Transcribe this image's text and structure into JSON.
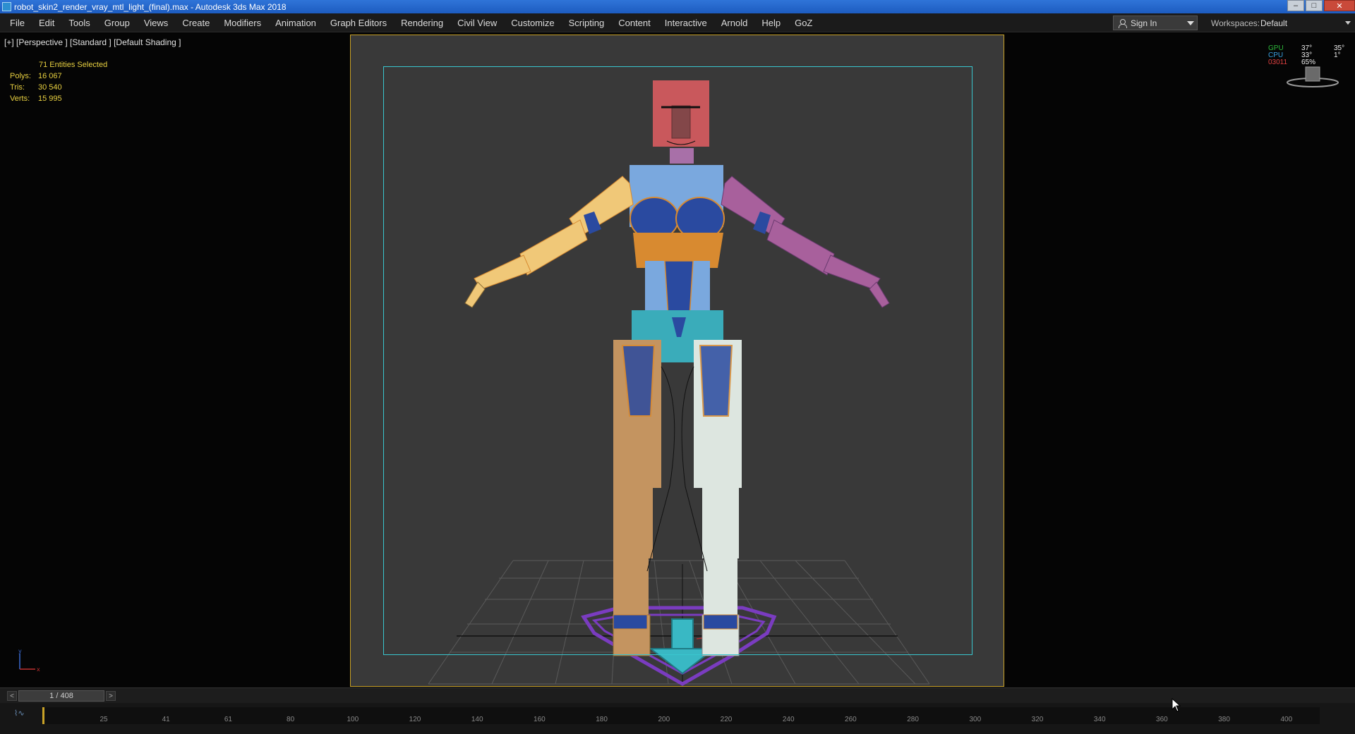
{
  "window": {
    "title": "robot_skin2_render_vray_mtl_light_(final).max - Autodesk 3ds Max 2018",
    "minimize": "–",
    "maximize": "□",
    "close": "✕"
  },
  "menu": {
    "items": [
      "File",
      "Edit",
      "Tools",
      "Group",
      "Views",
      "Create",
      "Modifiers",
      "Animation",
      "Graph Editors",
      "Rendering",
      "Civil View",
      "Customize",
      "Scripting",
      "Content",
      "Interactive",
      "Arnold",
      "Help",
      "GoZ"
    ],
    "sign_in": "Sign In",
    "workspaces_label": "Workspaces:",
    "workspace_value": "Default"
  },
  "viewport": {
    "label": "[+] [Perspective ] [Standard ] [Default Shading ]",
    "selection": "71 Entities Selected",
    "stats": [
      {
        "key": "Polys:",
        "value": "16 067"
      },
      {
        "key": "Tris:",
        "value": "30 540"
      },
      {
        "key": "Verts:",
        "value": "15 995"
      }
    ],
    "hud": {
      "gpu": "GPU",
      "cpu": "CPU",
      "fps": "03011",
      "gpu_v1": "37°",
      "gpu_v2": "35°",
      "cpu_v1": "33°",
      "cpu_v2": "1°",
      "fps_v1": "65%"
    },
    "axis": {
      "y": "y",
      "x": "x"
    },
    "colors": {
      "safe_frame": "#c9a227",
      "render_frame": "#39c6cf",
      "head": "#c9585c",
      "torso": "#7aa8de",
      "hips": "#3aacba",
      "left_arm": "#f0c878",
      "right_arm": "#a8609c",
      "left_leg": "#c49460",
      "right_leg": "#dde6e0",
      "wire_blue": "#2a4aa0",
      "wire_orange": "#d88a30",
      "base_purple": "#7a3cc0"
    }
  },
  "timeline": {
    "prev": "<",
    "next": ">",
    "frame": "1 / 408",
    "curve_icon": "curve-editor-icon",
    "ticks": [
      "25",
      "41",
      "61",
      "80",
      "100",
      "120",
      "140",
      "160",
      "180",
      "200",
      "220",
      "240",
      "260",
      "280",
      "300",
      "320",
      "340",
      "360",
      "380",
      "400"
    ]
  }
}
